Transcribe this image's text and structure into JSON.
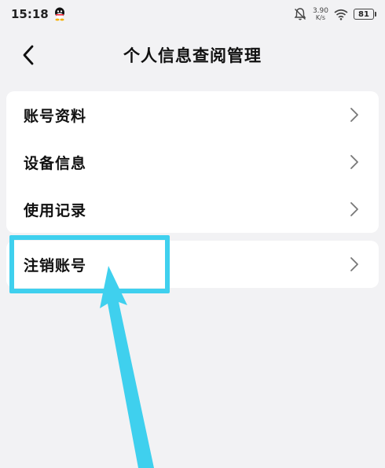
{
  "status_bar": {
    "time": "15:18",
    "net_speed_value": "3.90",
    "net_speed_unit": "K/s",
    "battery": "81",
    "icons": [
      "qq-icon",
      "mute-bell-icon",
      "wifi-icon",
      "battery-icon"
    ]
  },
  "header": {
    "title": "个人信息查阅管理",
    "back_icon": "chevron-left-icon"
  },
  "menu_group_1": [
    {
      "label": "账号资料",
      "icon": "chevron-right-icon"
    },
    {
      "label": "设备信息",
      "icon": "chevron-right-icon"
    },
    {
      "label": "使用记录",
      "icon": "chevron-right-icon"
    }
  ],
  "menu_group_2": [
    {
      "label": "注销账号",
      "icon": "chevron-right-icon"
    }
  ],
  "annotation": {
    "color": "#3fd0ee"
  }
}
